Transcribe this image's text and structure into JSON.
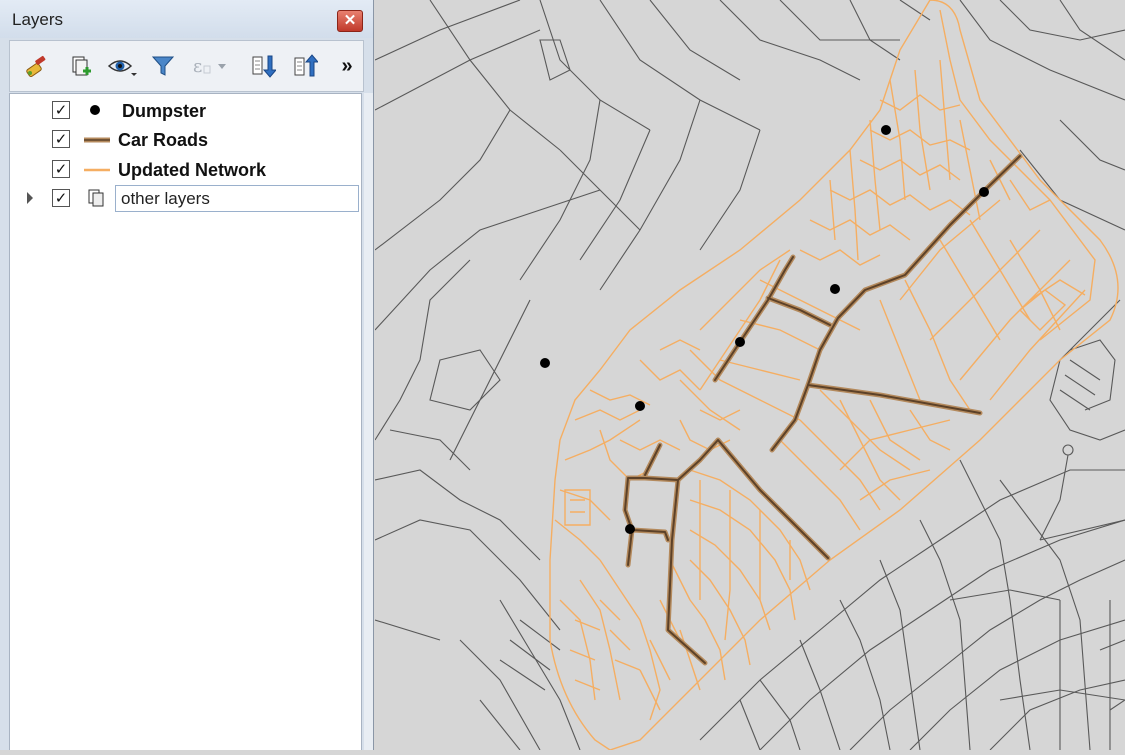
{
  "panel": {
    "title": "Layers",
    "close_glyph": "✕",
    "toolbar": [
      {
        "name": "style-manager-icon"
      },
      {
        "name": "add-group-icon"
      },
      {
        "name": "visibility-icon"
      },
      {
        "name": "filter-legend-icon"
      },
      {
        "name": "filter-expression-icon"
      },
      {
        "name": "expand-all-icon"
      },
      {
        "name": "collapse-all-icon"
      }
    ],
    "overflow_glyph": "»",
    "check_glyph": "✓",
    "layers": [
      {
        "label": "Dumpster",
        "checked": true,
        "symbol": "point"
      },
      {
        "label": "Car Roads",
        "checked": true,
        "symbol": "brown-line"
      },
      {
        "label": "Updated Network",
        "checked": true,
        "symbol": "orange-line"
      },
      {
        "label": "other layers",
        "checked": true,
        "symbol": "group",
        "editing": true
      }
    ]
  },
  "map": {
    "colors": {
      "background": "#d6d6d6",
      "base_roads": "#595959",
      "updated_network": "#f5ae62",
      "car_roads": "#5c4128",
      "car_roads_casing": "#b48a5d",
      "dumpster": "#000000"
    }
  }
}
